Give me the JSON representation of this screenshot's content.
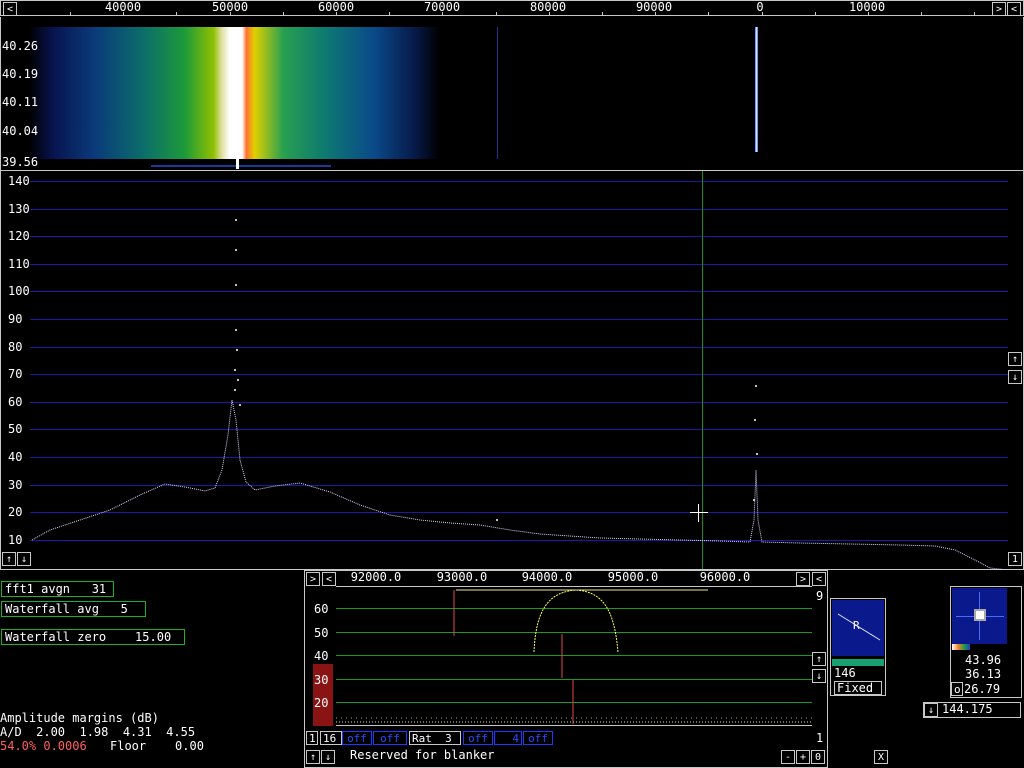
{
  "main_freq_axis": {
    "ticks_left": [
      "40000",
      "50000",
      "60000",
      "70000",
      "80000",
      "90000"
    ],
    "ticks_right": [
      "0",
      "10000"
    ]
  },
  "waterfall": {
    "labels": [
      "40.26",
      "40.19",
      "40.11",
      "40.04",
      "39.56"
    ]
  },
  "spectrum": {
    "y_labels": [
      "140",
      "130",
      "120",
      "110",
      "100",
      "90",
      "80",
      "70",
      "60",
      "50",
      "40",
      "30",
      "20",
      "10"
    ],
    "corner_label": "1"
  },
  "params": {
    "fft1_avgn": "fft1 avgn   31",
    "waterfall_avg": "Waterfall avg   5",
    "waterfall_zero": "Waterfall zero    15.00"
  },
  "amplitude": {
    "title": "Amplitude margins (dB)",
    "ad_line": "A/D  2.00  1.98  4.31  4.55",
    "status_pct": "54.0% 0.0006",
    "floor": "Floor    0.00"
  },
  "baseband": {
    "freq_ticks": [
      "92000.0",
      "93000.0",
      "94000.0",
      "95000.0",
      "96000.0"
    ],
    "y_labels": [
      "60",
      "50",
      "40",
      "30",
      "20"
    ],
    "top_right_number": "9",
    "bottom_right_number": "1",
    "controls": {
      "one": "1",
      "sixteen": "16",
      "off1": "off",
      "off2": "off",
      "rat": "Rat  3",
      "off3": "off",
      "four": "4",
      "off4": "off"
    },
    "blanker_text": "Reserved for blanker"
  },
  "polarization": {
    "label": "R",
    "value": "146",
    "mode": "Fixed"
  },
  "meter": {
    "v1": "43.96",
    "v2": "36.13",
    "o_label": "o",
    "v3": "26.79",
    "freq": "144.175"
  },
  "close_label": "X",
  "buttons": {
    "left": "<",
    "right": ">",
    "up": "↑",
    "down": "↓",
    "minus": "-",
    "plus": "+",
    "zero": "0"
  },
  "chart_data": {
    "type": "line",
    "peaks": [
      {
        "x": 50800,
        "y": 125
      },
      {
        "x": 95500,
        "y": 65
      }
    ],
    "ylim": [
      8,
      143
    ],
    "grid": true
  }
}
